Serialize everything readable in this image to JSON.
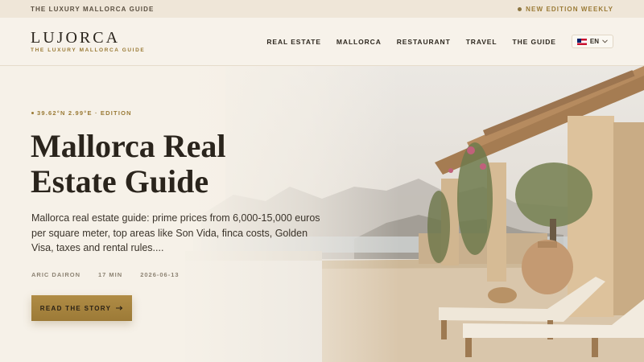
{
  "topbar": {
    "left_text": "THE LUXURY MALLORCA GUIDE",
    "right_text": "NEW EDITION WEEKLY"
  },
  "header": {
    "logo_name": "LUJORCA",
    "logo_tagline": "THE LUXURY MALLORCA GUIDE",
    "nav": [
      "REAL ESTATE",
      "MALLORCA",
      "RESTAURANT",
      "TRAVEL",
      "THE GUIDE"
    ],
    "language": "EN",
    "language_icon": "uk-flag-icon"
  },
  "hero": {
    "edition": "39.62°N 2.99°E · EDITION",
    "title_line1": "Mallorca Real",
    "title_line2": "Estate Guide",
    "description": "Mallorca real estate guide: prime prices from 6,000-15,000 euros per square meter, top areas like Son Vida, finca costs, Golden Visa, taxes and rental rules....",
    "author": "ARIC DAIRON",
    "read_time": "17 MIN",
    "date": "2026-06-13",
    "cta_label": "READ THE STORY",
    "cta_icon": "arrow-right-icon"
  },
  "colors": {
    "accent_gold": "#9c7a37",
    "text_dark": "#2a241c",
    "background": "#f4efe6"
  }
}
